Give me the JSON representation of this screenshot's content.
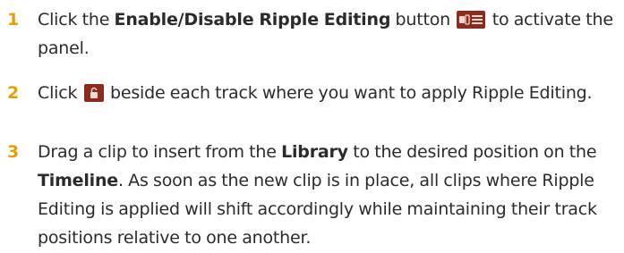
{
  "colors": {
    "step_number": "#e6a100",
    "text": "#2b2b2b",
    "icon_bg": "#8a2b1e",
    "icon_fg": "#f3d9d2"
  },
  "steps": [
    {
      "number": "1",
      "t1": "Click the ",
      "b1": "Enable/Disable Ripple Editing",
      "t2": " button ",
      "icon": "ripple-editing-toggle-icon",
      "t3": " to activate the panel."
    },
    {
      "number": "2",
      "t1": "Click ",
      "icon": "track-ripple-lock-icon",
      "t2": " beside each track where you want to apply Ripple Editing."
    },
    {
      "number": "3",
      "t1": "Drag a clip to insert from the ",
      "b1": "Library",
      "t2": " to the desired position on the ",
      "b2": "Timeline",
      "t3": ". As soon as the new clip is in place, all clips where Ripple Editing is applied will shift accordingly while maintaining their track positions relative to one another."
    }
  ]
}
